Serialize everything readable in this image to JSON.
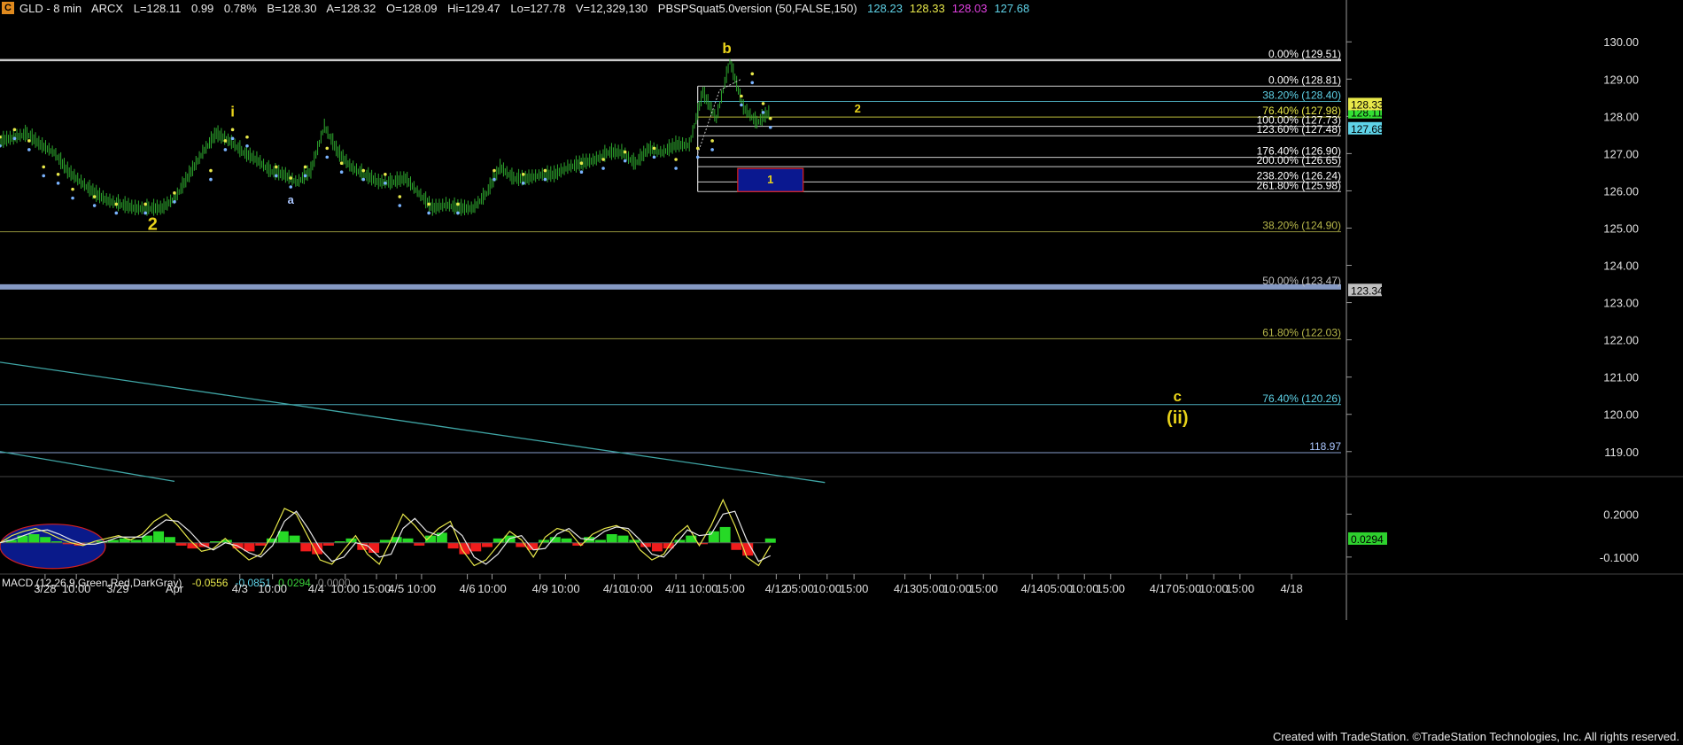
{
  "header": {
    "badge": "C",
    "symbol": "GLD - 8 min",
    "exchange": "ARCX",
    "last": "L=128.11",
    "change": "0.99",
    "pct": "0.78%",
    "bid": "B=128.30",
    "ask": "A=128.32",
    "open": "O=128.09",
    "high": "Hi=129.47",
    "low": "Lo=127.78",
    "volume": "V=12,329,130",
    "indicator": "PBSPSquat5.0version (50,FALSE,150)",
    "ind_values": [
      {
        "text": "128.23",
        "color": "#5fd3e8"
      },
      {
        "text": "128.33",
        "color": "#e8e84a"
      },
      {
        "text": "128.03",
        "color": "#e040e0"
      },
      {
        "text": "127.68",
        "color": "#5fd3e8"
      }
    ]
  },
  "macd_header": {
    "label": "MACD (12,26,9,Green,Red,DarkGray)",
    "values": [
      {
        "text": "-0.0556",
        "color": "#e8e84a"
      },
      {
        "text": "-0.0851",
        "color": "#5fd3e8"
      },
      {
        "text": "0.0294",
        "color": "#3ad13a"
      },
      {
        "text": "0.0000",
        "color": "#888888"
      }
    ]
  },
  "footer": "Created with TradeStation. ©TradeStation Technologies, Inc. All rights reserved.",
  "colors": {
    "background": "#000000",
    "price": "#2ea82e",
    "fib": "#ffffff",
    "wave_label": "#e8d21a",
    "trendline": "#3fa5a5",
    "macd_pos": "#26d926",
    "macd_neg": "#f01c1c"
  },
  "chart_data": {
    "type": "line",
    "y_axis": {
      "range": [
        118.4,
        130.6
      ],
      "ticks": [
        "130.00",
        "129.00",
        "128.00",
        "127.00",
        "126.00",
        "125.00",
        "124.00",
        "123.00",
        "122.00",
        "121.00",
        "120.00",
        "119.00"
      ]
    },
    "x_axis": {
      "ticks": [
        "3/28",
        "10:00",
        "3/29",
        "Apr",
        "4/3",
        "10:00",
        "4/4",
        "10:00",
        "15:00",
        "4/5",
        "10:00",
        "4/6",
        "10:00",
        "4/9",
        "10:00",
        "4/10",
        "10:00",
        "4/11",
        "10:00",
        "15:00",
        "4/12",
        "05:00",
        "10:00",
        "15:00",
        "4/13",
        "05:00",
        "10:00",
        "15:00",
        "4/14",
        "05:00",
        "10:00",
        "15:00",
        "4/17",
        "05:00",
        "10:00",
        "15:00",
        "4/18"
      ]
    },
    "series": [
      {
        "values": [
          127.3,
          127.4,
          127.5,
          127.2,
          127.0,
          126.5,
          126.2,
          125.9,
          125.7,
          125.6,
          125.5,
          125.5,
          125.5,
          125.8,
          126.4,
          127.0,
          127.5,
          127.3,
          127.0,
          126.8,
          126.5,
          126.4,
          126.2,
          126.5,
          127.7,
          127.0,
          126.6,
          126.4,
          126.2,
          126.2,
          126.3,
          125.9,
          125.5,
          125.6,
          125.5,
          125.5,
          125.9,
          126.6,
          126.3,
          126.3,
          126.4,
          126.4,
          126.6,
          126.7,
          126.8,
          127.0,
          127.0,
          126.7,
          127.1,
          127.0,
          127.2,
          127.2,
          128.6,
          127.9,
          129.45,
          128.2,
          127.8,
          128.1
        ]
      }
    ],
    "markers": [
      {
        "x": 0.0,
        "y": 127.3
      },
      {
        "x": 0.2,
        "y": 127.5
      },
      {
        "x": 0.4,
        "y": 127.2
      },
      {
        "x": 0.6,
        "y": 126.5
      },
      {
        "x": 0.8,
        "y": 126.3
      },
      {
        "x": 1.0,
        "y": 125.9
      },
      {
        "x": 1.3,
        "y": 125.7
      },
      {
        "x": 1.6,
        "y": 125.5
      },
      {
        "x": 2.0,
        "y": 125.5
      },
      {
        "x": 2.4,
        "y": 125.8
      },
      {
        "x": 2.9,
        "y": 126.4
      },
      {
        "x": 3.1,
        "y": 127.2
      },
      {
        "x": 3.2,
        "y": 127.5
      },
      {
        "x": 3.4,
        "y": 127.3
      },
      {
        "x": 3.8,
        "y": 126.5
      },
      {
        "x": 4.0,
        "y": 126.2
      },
      {
        "x": 4.2,
        "y": 126.5
      },
      {
        "x": 4.5,
        "y": 127.0
      },
      {
        "x": 4.7,
        "y": 126.6
      },
      {
        "x": 5.0,
        "y": 126.4
      },
      {
        "x": 5.3,
        "y": 126.3
      },
      {
        "x": 5.5,
        "y": 125.7
      },
      {
        "x": 5.9,
        "y": 125.5
      },
      {
        "x": 6.3,
        "y": 125.5
      },
      {
        "x": 6.8,
        "y": 126.4
      },
      {
        "x": 7.2,
        "y": 126.3
      },
      {
        "x": 7.5,
        "y": 126.4
      },
      {
        "x": 8.0,
        "y": 126.6
      },
      {
        "x": 8.3,
        "y": 126.7
      },
      {
        "x": 8.6,
        "y": 126.9
      },
      {
        "x": 9.0,
        "y": 127.0
      },
      {
        "x": 9.3,
        "y": 126.7
      },
      {
        "x": 9.6,
        "y": 127.0
      },
      {
        "x": 9.8,
        "y": 127.2
      },
      {
        "x": 10.2,
        "y": 128.4
      },
      {
        "x": 10.35,
        "y": 129.0
      },
      {
        "x": 10.5,
        "y": 128.2
      },
      {
        "x": 10.6,
        "y": 127.8
      }
    ],
    "fib_levels": [
      {
        "label": "0.00%",
        "value": "129.51",
        "price": 129.51,
        "x_from": 0.0,
        "x_to": 18.5,
        "color": "#ffffff"
      },
      {
        "label": "0.00%",
        "value": "128.81",
        "price": 128.81,
        "x_from": 9.6,
        "x_to": 18.5,
        "color": "#ffffff"
      },
      {
        "label": "38.20%",
        "value": "128.40",
        "price": 128.4,
        "x_from": 9.6,
        "x_to": 18.5,
        "color": "#5fd3e8"
      },
      {
        "label": "76.40%",
        "value": "127.98",
        "price": 127.98,
        "x_from": 9.6,
        "x_to": 18.5,
        "color": "#e8e84a"
      },
      {
        "label": "100.00%",
        "value": "127.73",
        "price": 127.73,
        "x_from": 9.6,
        "x_to": 18.5,
        "color": "#ffffff"
      },
      {
        "label": "123.60%",
        "value": "127.48",
        "price": 127.48,
        "x_from": 9.6,
        "x_to": 18.5,
        "color": "#ffffff"
      },
      {
        "label": "176.40%",
        "value": "126.90",
        "price": 126.9,
        "x_from": 9.6,
        "x_to": 18.5,
        "color": "#ffffff"
      },
      {
        "label": "200.00%",
        "value": "126.65",
        "price": 126.65,
        "x_from": 9.6,
        "x_to": 18.5,
        "color": "#ffffff"
      },
      {
        "label": "238.20%",
        "value": "126.24",
        "price": 126.24,
        "x_from": 9.6,
        "x_to": 18.5,
        "color": "#ffffff"
      },
      {
        "label": "261.80%",
        "value": "125.98",
        "price": 125.98,
        "x_from": 9.6,
        "x_to": 18.5,
        "color": "#ffffff"
      },
      {
        "label": "38.20%",
        "value": "124.90",
        "price": 124.9,
        "x_from": 0.0,
        "x_to": 18.5,
        "color": "#b8b84a"
      },
      {
        "label": "50.00%",
        "value": "123.47",
        "price": 123.42,
        "x_from": 0.0,
        "x_to": 18.5,
        "color": "#bfbfbf"
      },
      {
        "label": "61.80%",
        "value": "122.03",
        "price": 122.03,
        "x_from": 0.0,
        "x_to": 18.5,
        "color": "#b8b84a"
      },
      {
        "label": "76.40%",
        "value": "120.26",
        "price": 120.26,
        "x_from": 0.0,
        "x_to": 18.5,
        "color": "#5fd3e8"
      },
      {
        "label": "",
        "value": "118.97",
        "price": 118.97,
        "x_from": 0.0,
        "x_to": 18.5,
        "color": "#aac6ff"
      }
    ],
    "price_badges": [
      {
        "text": "128.11",
        "price": 128.11,
        "color": "#33e033"
      },
      {
        "text": "127.68",
        "price": 127.68,
        "color": "#5fd3e8"
      },
      {
        "text": "128.33",
        "price": 128.33,
        "color": "#e8e84a"
      },
      {
        "text": "123.34",
        "price": 123.34,
        "color": "#bfbfbf"
      }
    ],
    "wave_labels": [
      {
        "text": "2",
        "x": 2.1,
        "y": 124.95,
        "size": "large",
        "color": "#e8d21a"
      },
      {
        "text": "i",
        "x": 3.2,
        "y": 128.0,
        "size": "medium",
        "color": "#e8d21a"
      },
      {
        "text": "a",
        "x": 4.0,
        "y": 125.65,
        "size": "small",
        "color": "#aac6ff"
      },
      {
        "text": "b",
        "x": 10.0,
        "y": 129.7,
        "size": "medium",
        "color": "#e8d21a"
      },
      {
        "text": "2",
        "x": 11.8,
        "y": 128.1,
        "size": "small",
        "color": "#e8d21a"
      },
      {
        "text": "1",
        "x": 10.6,
        "y": 126.2,
        "size": "small",
        "color": "#e8d21a"
      },
      {
        "text": "c",
        "x": 16.2,
        "y": 120.35,
        "size": "medium",
        "color": "#e8d21a"
      },
      {
        "text": "(ii)",
        "x": 16.2,
        "y": 119.75,
        "size": "large",
        "color": "#e8d21a"
      }
    ],
    "target_box": {
      "x_from": 10.15,
      "x_to": 11.05,
      "y_from": 126.6,
      "y_to": 125.98
    },
    "trendlines": [
      {
        "x1": 0.0,
        "y1": 121.4,
        "x2": 11.35,
        "y2": 118.17
      },
      {
        "x1": 0.0,
        "y1": 119.0,
        "x2": 2.4,
        "y2": 118.2
      }
    ],
    "macd": {
      "y_range": [
        -0.2,
        0.45
      ],
      "ticks": [
        "0.2000",
        "-0.1000"
      ],
      "tick_values": [
        0.2,
        -0.1
      ],
      "badge": "0.0294",
      "hist": [
        0.0,
        0.02,
        0.05,
        0.06,
        0.04,
        0.01,
        -0.01,
        -0.02,
        0.0,
        0.01,
        0.02,
        0.03,
        0.02,
        0.05,
        0.08,
        0.04,
        -0.02,
        -0.04,
        -0.03,
        0.01,
        0.02,
        -0.04,
        -0.06,
        -0.02,
        0.03,
        0.08,
        0.05,
        -0.06,
        -0.08,
        -0.02,
        0.01,
        0.03,
        -0.05,
        -0.07,
        0.02,
        0.04,
        0.03,
        -0.02,
        0.05,
        0.07,
        -0.04,
        -0.08,
        -0.06,
        -0.03,
        0.03,
        0.05,
        -0.03,
        -0.05,
        0.02,
        0.04,
        0.03,
        -0.02,
        0.04,
        0.02,
        0.06,
        0.05,
        0.02,
        -0.03,
        -0.06,
        -0.04,
        0.02,
        0.05,
        -0.01,
        0.08,
        0.11,
        -0.05,
        -0.09,
        0.0,
        0.03
      ],
      "macd_line": [
        0.0,
        0.05,
        0.08,
        0.1,
        0.07,
        0.03,
        0.0,
        -0.02,
        0.01,
        0.03,
        0.05,
        0.02,
        0.06,
        0.15,
        0.2,
        0.12,
        0.02,
        -0.06,
        -0.04,
        0.03,
        -0.05,
        -0.12,
        -0.08,
        0.06,
        0.24,
        0.2,
        0.04,
        -0.12,
        -0.15,
        -0.05,
        0.05,
        -0.08,
        -0.15,
        0.02,
        0.2,
        0.12,
        0.02,
        0.1,
        0.15,
        -0.05,
        -0.16,
        -0.12,
        -0.02,
        0.08,
        0.02,
        -0.1,
        0.04,
        0.1,
        0.08,
        -0.02,
        0.06,
        0.1,
        0.12,
        0.08,
        -0.05,
        -0.12,
        -0.08,
        0.05,
        0.12,
        -0.02,
        0.12,
        0.3,
        0.12,
        -0.1,
        -0.16,
        -0.02
      ],
      "signal_line": [
        0.0,
        0.02,
        0.05,
        0.08,
        0.09,
        0.06,
        0.02,
        -0.01,
        -0.01,
        0.01,
        0.04,
        0.04,
        0.04,
        0.1,
        0.16,
        0.15,
        0.08,
        -0.01,
        -0.05,
        0.0,
        -0.02,
        -0.07,
        -0.1,
        -0.02,
        0.15,
        0.22,
        0.1,
        -0.04,
        -0.13,
        -0.1,
        0.0,
        -0.02,
        -0.1,
        -0.08,
        0.1,
        0.17,
        0.08,
        0.05,
        0.12,
        0.05,
        -0.1,
        -0.15,
        -0.08,
        0.03,
        0.05,
        -0.05,
        -0.04,
        0.06,
        0.1,
        0.03,
        0.02,
        0.08,
        0.11,
        0.1,
        0.02,
        -0.08,
        -0.1,
        -0.01,
        0.09,
        0.05,
        0.06,
        0.2,
        0.22,
        0.02,
        -0.13,
        -0.09
      ],
      "ellipse": {
        "x_from": 0.0,
        "x_to": 1.45,
        "y_from": 0.13,
        "y_to": -0.18
      }
    }
  }
}
